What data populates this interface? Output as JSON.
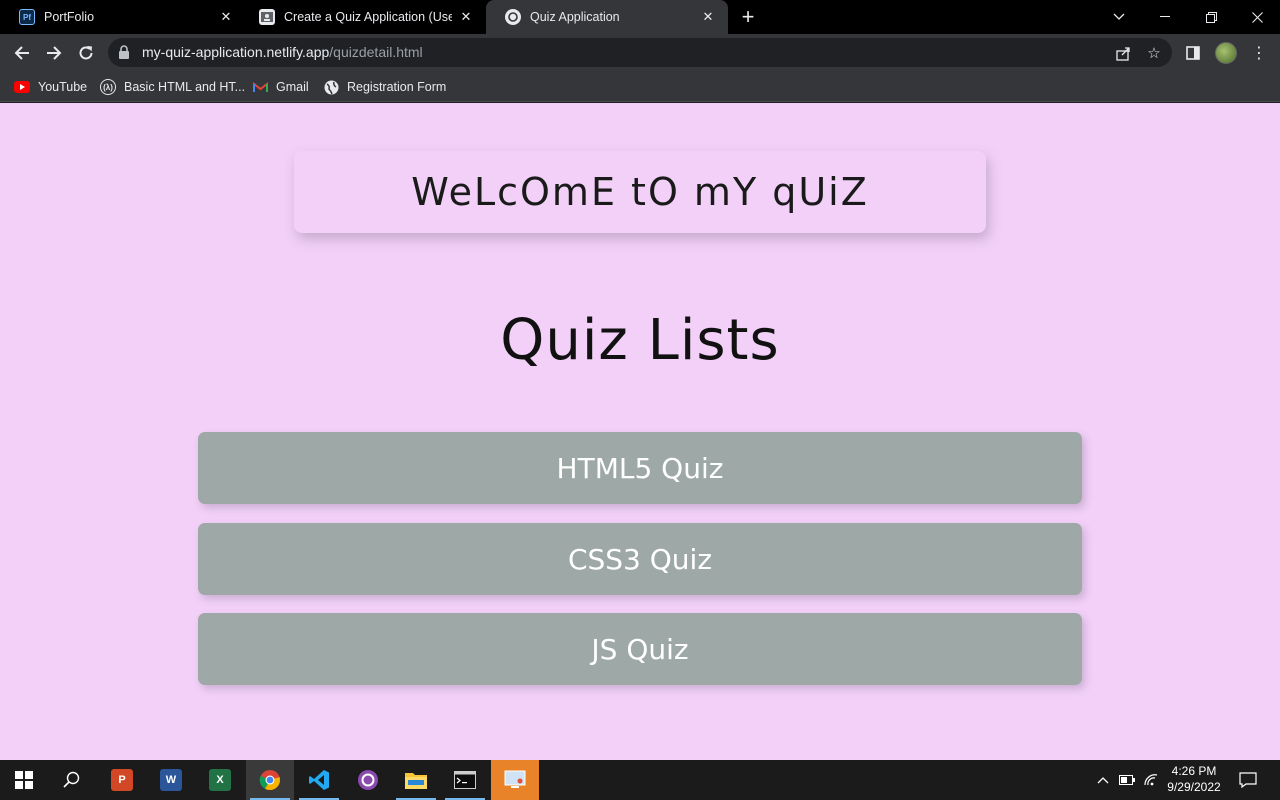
{
  "browser": {
    "tabs": [
      {
        "label": "PortFolio",
        "favicon": "Pf"
      },
      {
        "label": "Create a Quiz Application (Use A",
        "favicon": "person-card-icon"
      },
      {
        "label": "Quiz Application",
        "favicon": "netlify-icon"
      }
    ],
    "address": {
      "domain": "my-quiz-application.netlify.app",
      "path": "/quizdetail.html"
    },
    "bookmarks": [
      {
        "label": "YouTube"
      },
      {
        "label": "Basic HTML and HT..."
      },
      {
        "label": "Gmail"
      },
      {
        "label": "Registration Form"
      }
    ]
  },
  "page": {
    "welcome": "WeLcOmE tO mY qUiZ",
    "heading": "Quiz Lists",
    "quizzes": [
      {
        "label": "HTML5 Quiz"
      },
      {
        "label": "CSS3 Quiz"
      },
      {
        "label": "JS Quiz"
      }
    ],
    "colors": {
      "background": "#f2d0f8",
      "button": "#9ea8a6",
      "button_text": "#ffffff"
    }
  },
  "taskbar": {
    "apps": [
      "windows-start-icon",
      "search-icon",
      "powerpoint-icon",
      "word-icon",
      "excel-icon",
      "chrome-icon",
      "vscode-icon",
      "github-desktop-icon",
      "file-explorer-icon",
      "terminal-icon",
      "remote-desktop-icon"
    ],
    "time": "4:26 PM",
    "date": "9/29/2022"
  }
}
